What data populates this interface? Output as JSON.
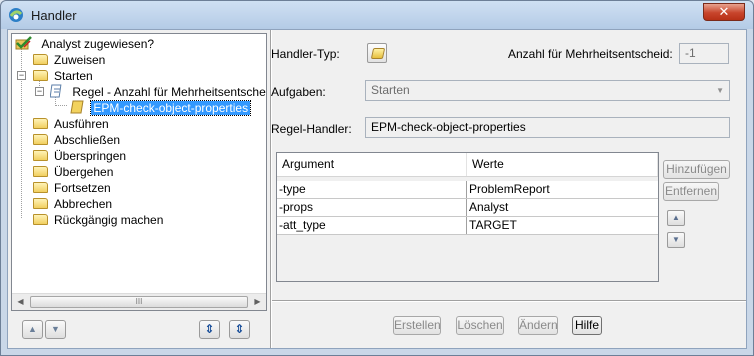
{
  "window": {
    "title": "Handler",
    "close_glyph": "✕",
    "icon": "app-logo-icon"
  },
  "tree": {
    "root": "Analyst zugewiesen?",
    "items": [
      "Zuweisen",
      "Starten",
      "Regel - Anzahl für Mehrheitsentsche",
      "EPM-check-object-properties",
      "Ausführen",
      "Abschließen",
      "Überspringen",
      "Übergehen",
      "Fortsetzen",
      "Abbrechen",
      "Rückgängig machen"
    ],
    "expander_minus": "−",
    "scroll_left": "◀",
    "scroll_right": "▶",
    "scroll_grip": "III"
  },
  "tree_buttons": {
    "up": "▲",
    "down": "▼",
    "expand_all": "⇕",
    "collapse_all": "⇕"
  },
  "form": {
    "handler_type_label": "Handler-Typ:",
    "quorum_label": "Anzahl für Mehrheitsentscheid:",
    "quorum_value": "-1",
    "tasks_label": "Aufgaben:",
    "tasks_value": "Starten",
    "rule_handler_label": "Regel-Handler:",
    "rule_handler_value": "EPM-check-object-properties"
  },
  "table": {
    "columns": [
      "Argument",
      "Werte"
    ],
    "rows": [
      [
        "-type",
        "ProblemReport"
      ],
      [
        "-props",
        "Analyst"
      ],
      [
        "-att_type",
        "TARGET"
      ]
    ]
  },
  "table_buttons": {
    "add": "Hinzufügen",
    "remove": "Entfernen",
    "up": "▲",
    "down": "▼"
  },
  "footer_buttons": {
    "create": "Erstellen",
    "delete": "Löschen",
    "modify": "Ändern",
    "help": "Hilfe"
  }
}
